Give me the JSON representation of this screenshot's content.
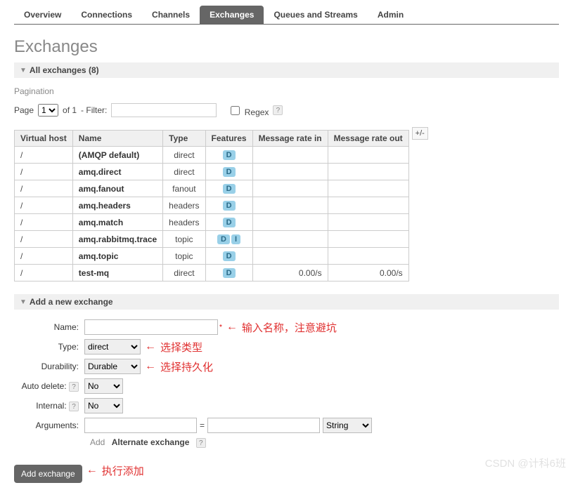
{
  "tabs": {
    "overview": "Overview",
    "connections": "Connections",
    "channels": "Channels",
    "exchanges": "Exchanges",
    "queues": "Queues and Streams",
    "admin": "Admin"
  },
  "page_title": "Exchanges",
  "all_exchanges": {
    "label": "All exchanges",
    "count": "(8)"
  },
  "pagination": {
    "label": "Pagination",
    "page_label": "Page",
    "page_value": "1",
    "of_label": "of 1",
    "filter_label": "- Filter:",
    "regex_label": "Regex",
    "help": "?"
  },
  "table": {
    "headers": {
      "vhost": "Virtual host",
      "name": "Name",
      "type": "Type",
      "features": "Features",
      "rate_in": "Message rate in",
      "rate_out": "Message rate out"
    },
    "plus_minus": "+/-",
    "rows": [
      {
        "vhost": "/",
        "name": "(AMQP default)",
        "type": "direct",
        "features": [
          "D"
        ],
        "rate_in": "",
        "rate_out": ""
      },
      {
        "vhost": "/",
        "name": "amq.direct",
        "type": "direct",
        "features": [
          "D"
        ],
        "rate_in": "",
        "rate_out": ""
      },
      {
        "vhost": "/",
        "name": "amq.fanout",
        "type": "fanout",
        "features": [
          "D"
        ],
        "rate_in": "",
        "rate_out": ""
      },
      {
        "vhost": "/",
        "name": "amq.headers",
        "type": "headers",
        "features": [
          "D"
        ],
        "rate_in": "",
        "rate_out": ""
      },
      {
        "vhost": "/",
        "name": "amq.match",
        "type": "headers",
        "features": [
          "D"
        ],
        "rate_in": "",
        "rate_out": ""
      },
      {
        "vhost": "/",
        "name": "amq.rabbitmq.trace",
        "type": "topic",
        "features": [
          "D",
          "I"
        ],
        "rate_in": "",
        "rate_out": ""
      },
      {
        "vhost": "/",
        "name": "amq.topic",
        "type": "topic",
        "features": [
          "D"
        ],
        "rate_in": "",
        "rate_out": ""
      },
      {
        "vhost": "/",
        "name": "test-mq",
        "type": "direct",
        "features": [
          "D"
        ],
        "rate_in": "0.00/s",
        "rate_out": "0.00/s"
      }
    ]
  },
  "add_section": {
    "title": "Add a new exchange",
    "name_label": "Name:",
    "type_label": "Type:",
    "type_value": "direct",
    "durability_label": "Durability:",
    "durability_value": "Durable",
    "auto_delete_label": "Auto delete:",
    "auto_delete_value": "No",
    "internal_label": "Internal:",
    "internal_value": "No",
    "arguments_label": "Arguments:",
    "args_equals": "=",
    "args_type": "String",
    "add_word": "Add",
    "alternate_exchange": "Alternate exchange",
    "help": "?",
    "button": "Add exchange"
  },
  "annotations": {
    "name_note": "输入名称，注意避坑",
    "type_note": "选择类型",
    "durability_note": "选择持久化",
    "button_note": "执行添加",
    "arrow": "←"
  },
  "watermark": "CSDN @计科6班"
}
